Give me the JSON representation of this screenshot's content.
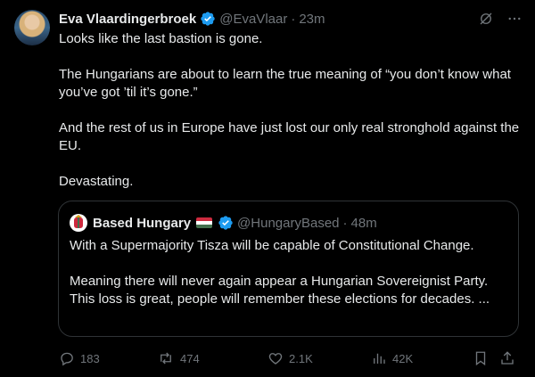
{
  "tweet": {
    "name": "Eva Vlaardingerbroek",
    "handle": "@EvaVlaar",
    "separator": "·",
    "time": "23m",
    "paragraphs": [
      "Looks like the last bastion is gone.",
      "The Hungarians are about to learn the true meaning of “you don’t know what you’ve got ’til it’s gone.”",
      "And the rest of us in Europe have just lost our only real stronghold against the EU.",
      "Devastating."
    ]
  },
  "quote": {
    "name": "Based Hungary",
    "handle": "@HungaryBased",
    "separator": "·",
    "time": "48m",
    "paragraphs": [
      "With a Supermajority Tisza will be capable of Constitutional Change.",
      "Meaning there will never again appear a Hungarian Sovereignist Party. This loss is great, people will remember these elections for decades. ..."
    ],
    "flag_colors": [
      "#cd2a3e",
      "#ffffff",
      "#436f4d"
    ]
  },
  "actions": {
    "replies": "183",
    "reposts": "474",
    "likes": "2.1K",
    "views": "42K"
  },
  "colors": {
    "background": "#000000",
    "text": "#e7e9ea",
    "muted": "#71767b",
    "verified": "#1d9bf0",
    "border": "#2f3336"
  }
}
